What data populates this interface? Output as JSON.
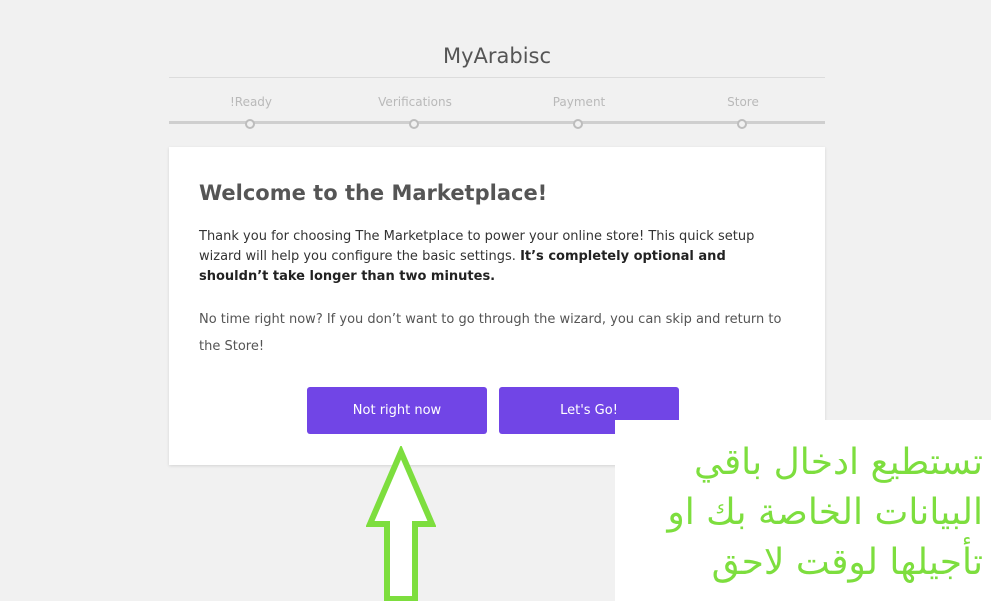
{
  "header": {
    "site_title": "MyArabisc"
  },
  "steps": [
    {
      "label": "!Ready"
    },
    {
      "label": "Verifications"
    },
    {
      "label": "Payment"
    },
    {
      "label": "Store"
    }
  ],
  "welcome": {
    "heading": "Welcome to the Marketplace!",
    "intro_text": "Thank you for choosing The Marketplace to power your online store! This quick setup wizard will help you configure the basic settings. ",
    "intro_bold": "It’s completely optional and shouldn’t take longer than two minutes.",
    "skip_text": "No time right now? If you don’t want to go through the wizard, you can skip and return to the Store!"
  },
  "buttons": {
    "not_now": "Not right now",
    "lets_go": "Let's Go!"
  },
  "annotation": {
    "note_text": "تستطيع ادخال باقي البيانات الخاصة بك او تأجيلها لوقت لاحق"
  },
  "colors": {
    "accent": "#7145e6",
    "annotation_green": "#7dde3e",
    "background": "#f1f1f1"
  }
}
